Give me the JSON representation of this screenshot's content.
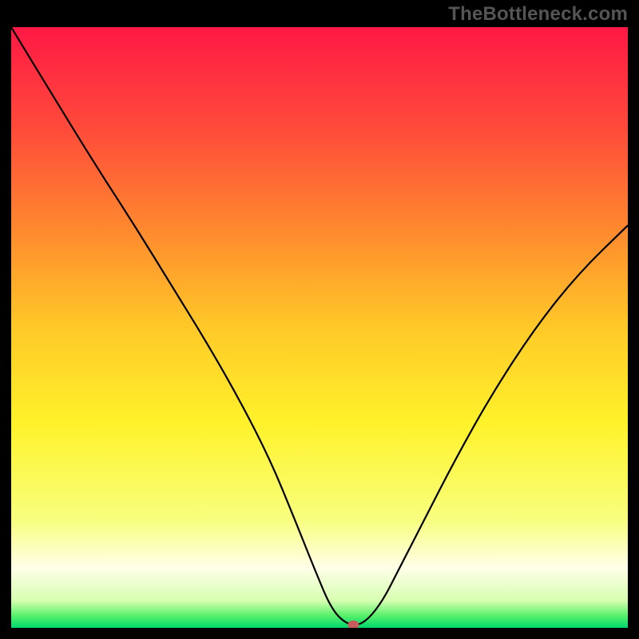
{
  "watermark": "TheBottleneck.com",
  "chart_data": {
    "type": "line",
    "title": "",
    "xlabel": "",
    "ylabel": "",
    "xlim": [
      0,
      100
    ],
    "ylim": [
      0,
      100
    ],
    "series": [
      {
        "name": "curve",
        "x": [
          0,
          6.5,
          13.7,
          20,
          26,
          32,
          37,
          42,
          46,
          49.5,
          52,
          54.5,
          57,
          60,
          63,
          67,
          72,
          78,
          85,
          92,
          100
        ],
        "y": [
          100,
          89,
          77,
          67,
          57,
          47,
          38,
          28,
          18,
          9,
          3,
          0.5,
          0.5,
          4,
          10,
          18,
          28,
          39,
          50,
          59,
          67
        ]
      }
    ],
    "marker": {
      "x": 55.5,
      "y": 0.5,
      "color": "#c85b5b"
    },
    "gradient_stops": [
      {
        "offset": 0.0,
        "color": "#ff1845"
      },
      {
        "offset": 0.17,
        "color": "#ff4b3a"
      },
      {
        "offset": 0.34,
        "color": "#ff8a2e"
      },
      {
        "offset": 0.5,
        "color": "#ffc928"
      },
      {
        "offset": 0.66,
        "color": "#fff22a"
      },
      {
        "offset": 0.82,
        "color": "#f8ff7e"
      },
      {
        "offset": 0.9,
        "color": "#ffffe8"
      },
      {
        "offset": 0.955,
        "color": "#d6ffb0"
      },
      {
        "offset": 0.98,
        "color": "#56f06a"
      },
      {
        "offset": 1.0,
        "color": "#00d86f"
      }
    ]
  }
}
